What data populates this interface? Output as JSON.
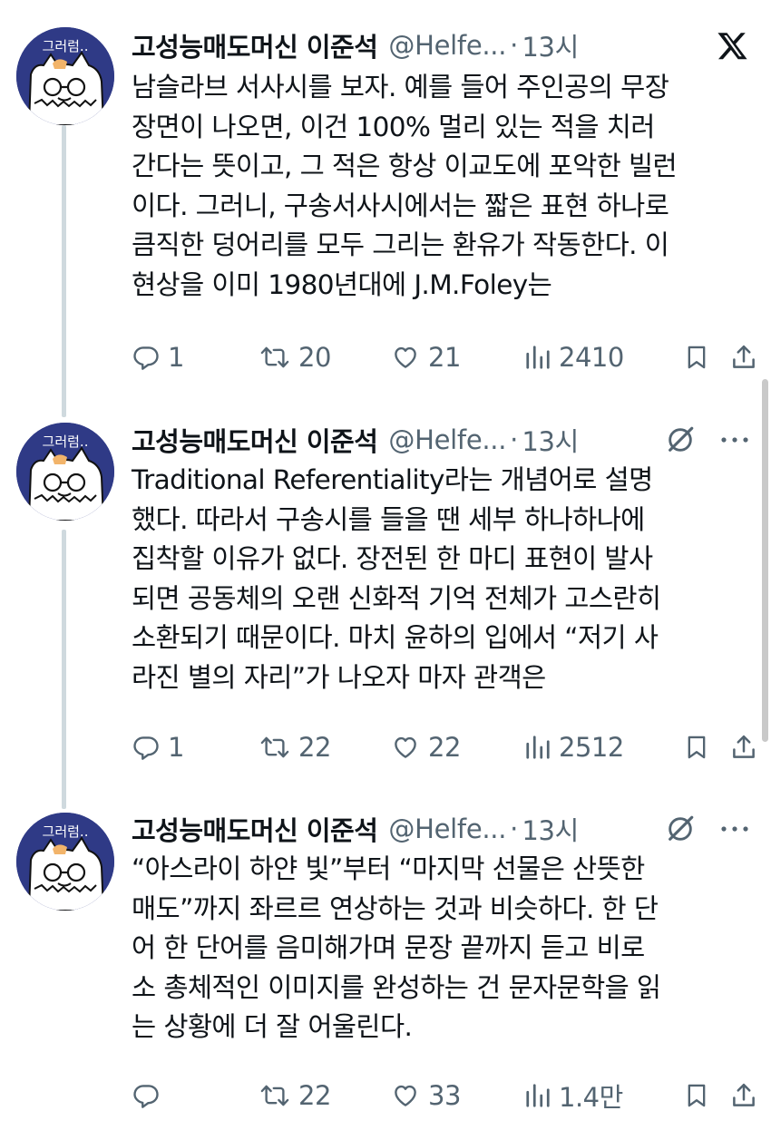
{
  "tweets": [
    {
      "name": "고성능매도머신 이준석",
      "handle": "@Helfe...",
      "dot": "·",
      "time": "13시",
      "avatar_text": "그러럼..",
      "header_icon": "x-logo-icon",
      "text": "남슬라브 서사시를 보자. 예를 들어 주인공의 무장\n장면이 나오면, 이건 100% 멀리 있는 적을 치러\n간다는 뜻이고, 그 적은 항상 이교도에 포악한 빌런\n이다. 그러니, 구송서사시에서는 짧은 표현 하나로\n큼직한 덩어리를 모두 그리는 환유가 작동한다. 이\n현상을 이미 1980년대에 J.M.Foley는",
      "replies": "1",
      "retweets": "20",
      "likes": "21",
      "views": "2410"
    },
    {
      "name": "고성능매도머신 이준석",
      "handle": "@Helfe...",
      "dot": "·",
      "time": "13시",
      "avatar_text": "그러럼..",
      "header_icon": "grok-icon",
      "text": "Traditional Referentiality라는 개념어로 설명\n했다. 따라서 구송시를 들을 땐 세부 하나하나에\n집착할 이유가 없다. 장전된 한 마디 표현이 발사\n되면 공동체의 오랜 신화적 기억 전체가 고스란히\n소환되기 때문이다. 마치 윤하의 입에서 “저기 사\n라진 별의 자리”가 나오자 마자 관객은",
      "replies": "1",
      "retweets": "22",
      "likes": "22",
      "views": "2512"
    },
    {
      "name": "고성능매도머신 이준석",
      "handle": "@Helfe...",
      "dot": "·",
      "time": "13시",
      "avatar_text": "그러럼..",
      "header_icon": "grok-icon",
      "text": "“아스라이 하얀 빛”부터 “마지막 선물은 산뜻한\n매도”까지 좌르르 연상하는 것과 비슷하다. 한 단\n어 한 단어를 음미해가며 문장 끝까지 듣고 비로\n소 총체적인 이미지를 완성하는 건 문자문학을 읽\n는 상황에 더 잘 어울린다.",
      "replies": "",
      "retweets": "22",
      "likes": "33",
      "views": "1.4만"
    }
  ],
  "colors": {
    "text": "#0f1419",
    "secondary": "#536471",
    "thread_line": "#cfd9de",
    "avatar_bg": "#2f3a86"
  }
}
